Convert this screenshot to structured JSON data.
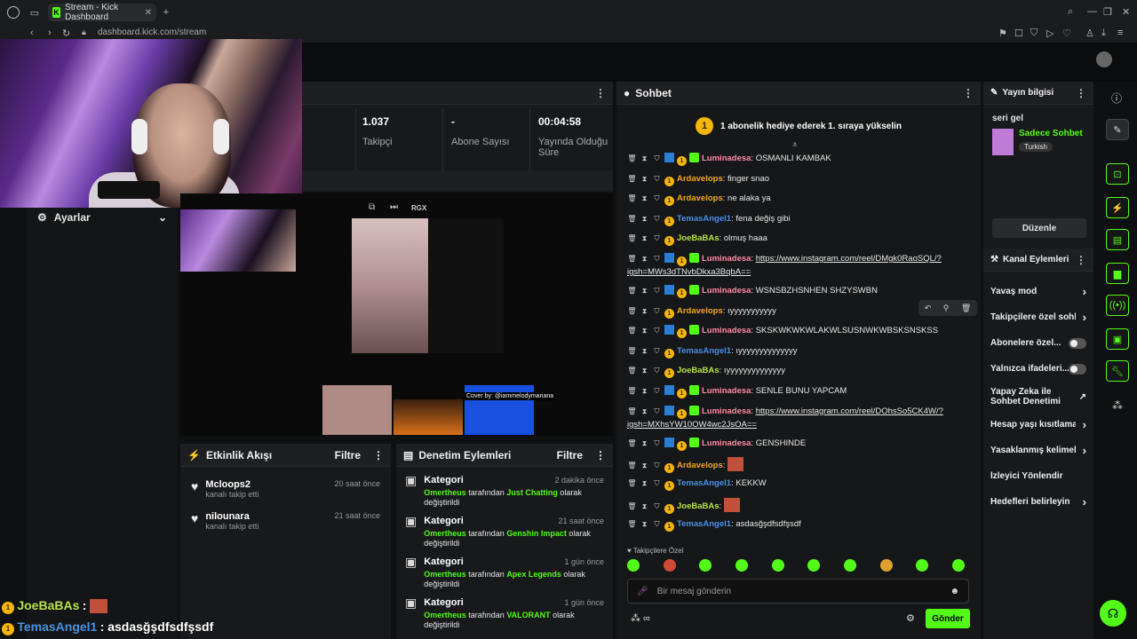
{
  "browser": {
    "tab_title": "Stream - Kick Dashboard",
    "url": "dashboard.kick.com/stream",
    "new_tab": "+"
  },
  "stats": {
    "followers_value": "1.037",
    "followers_label": "Takipçi",
    "subs_value": "-",
    "subs_label": "Abone Sayısı",
    "live_value": "00:04:58",
    "live_label": "Yayında Olduğu Süre"
  },
  "settings": {
    "label": "Ayarlar"
  },
  "preview": {
    "ctrl_label": "RGX",
    "cover_text": "Cover by: @iammelodymariana"
  },
  "activity": {
    "title": "Etkinlik Akışı",
    "filter": "Filtre",
    "items": [
      {
        "user": "Mcloops2",
        "action": "kanalı takip etti",
        "time": "20 saat önce"
      },
      {
        "user": "nilounara",
        "action": "kanalı takip etti",
        "time": "21 saat önce"
      }
    ]
  },
  "moderation": {
    "title": "Denetim Eylemleri",
    "filter": "Filtre",
    "items": [
      {
        "title": "Kategori",
        "time": "2 dakika önce",
        "user": "Omertheus",
        "mid": "tarafından",
        "target": "Just Chatting",
        "end": "olarak değiştirildi"
      },
      {
        "title": "Kategori",
        "time": "21 saat önce",
        "user": "Omertheus",
        "mid": "tarafından",
        "target": "Genshin Impact",
        "end": "olarak değiştirildi"
      },
      {
        "title": "Kategori",
        "time": "1 gün önce",
        "user": "Omertheus",
        "mid": "tarafından",
        "target": "Apex Legends",
        "end": "olarak değiştirildi"
      },
      {
        "title": "Kategori",
        "time": "1 gün önce",
        "user": "Omertheus",
        "mid": "tarafından",
        "target": "VALORANT",
        "end": "olarak değiştirildi"
      }
    ]
  },
  "chat": {
    "title": "Sohbet",
    "pinned": "1 abonelik hediye ederek 1. sıraya yükselin",
    "pinned_badge": "1",
    "followers_only_label": "Takipçilere Özel",
    "input_placeholder": "Bir mesaj gönderin",
    "send_label": "Gönder",
    "messages": [
      {
        "user": "Luminadesa",
        "color": "#ff8aa8",
        "text": "OSMANLI KAMBAK",
        "badges": 3
      },
      {
        "user": "Ardavelops",
        "color": "#f5a623",
        "text": "finger snao",
        "badges": 1
      },
      {
        "user": "Ardavelops",
        "color": "#f5a623",
        "text": "ne alaka ya",
        "badges": 1
      },
      {
        "user": "TemasAngel1",
        "color": "#4a90e2",
        "text": "fena değiş gibi",
        "badges": 1
      },
      {
        "user": "JoeBaBAs",
        "color": "#b6e24a",
        "text": "olmuş haaa",
        "badges": 1
      },
      {
        "user": "Luminadesa",
        "color": "#ff8aa8",
        "text": "https://www.instagram.com/reel/DMgk0RaoSQL/?igsh=MWs3dTNvbDkxa3BqbA==",
        "badges": 3,
        "link": true
      },
      {
        "user": "Luminadesa",
        "color": "#ff8aa8",
        "text": "WSNSBZHSNHEN SHZYSWBN",
        "badges": 3
      },
      {
        "user": "Ardavelops",
        "color": "#f5a623",
        "text": "ıyyyyyyyyyyy",
        "badges": 1
      },
      {
        "user": "Luminadesa",
        "color": "#ff8aa8",
        "text": "SKSKWKWKWLAKWLSUSNWKWBSKSNSKSS",
        "badges": 3
      },
      {
        "user": "TemasAngel1",
        "color": "#4a90e2",
        "text": "ıyyyyyyyyyyyyyy",
        "badges": 1
      },
      {
        "user": "JoeBaBAs",
        "color": "#b6e24a",
        "text": "ıyyyyyyyyyyyyyy",
        "badges": 1
      },
      {
        "user": "Luminadesa",
        "color": "#ff8aa8",
        "text": "SENLE BUNU YAPCAM",
        "badges": 3
      },
      {
        "user": "Luminadesa",
        "color": "#ff8aa8",
        "text": "https://www.instagram.com/reel/DOhsSo5CK4W/?igsh=MXhsYW10OW4wc2JsOA==",
        "badges": 3,
        "link": true
      },
      {
        "user": "Luminadesa",
        "color": "#ff8aa8",
        "text": "GENSHINDE",
        "badges": 3
      },
      {
        "user": "Ardavelops",
        "color": "#f5a623",
        "text": "",
        "badges": 1,
        "emote": true
      },
      {
        "user": "TemasAngel1",
        "color": "#4a90e2",
        "text": "KEKKW",
        "badges": 1
      },
      {
        "user": "JoeBaBAs",
        "color": "#b6e24a",
        "text": "",
        "badges": 1,
        "emote": true
      },
      {
        "user": "TemasAngel1",
        "color": "#4a90e2",
        "text": "asdasğşdfsdfşsdf",
        "badges": 1
      }
    ]
  },
  "stream_info": {
    "title": "Yayın bilgisi",
    "stream_title": "seri gel",
    "chat_mode": "Sadece Sohbet",
    "language": "Turkish",
    "edit_label": "Düzenle"
  },
  "channel_actions": {
    "title": "Kanal Eylemleri",
    "items": [
      {
        "label": "Yavaş mod",
        "control": "chevron"
      },
      {
        "label": "Takipçilere özel sohbe",
        "control": "chevron"
      },
      {
        "label": "Abonelere özel...",
        "control": "toggle"
      },
      {
        "label": "Yalnızca ifadeleri...",
        "control": "toggle"
      },
      {
        "label": "Yapay Zeka ile Sohbet Denetimi",
        "control": "external"
      },
      {
        "label": "Hesap yaşı kısıtlaması",
        "control": "chevron"
      },
      {
        "label": "Yasaklanmış kelimeler",
        "control": "chevron"
      },
      {
        "label": "İzleyici Yönlendir",
        "control": "none"
      },
      {
        "label": "Hedefleri belirleyin",
        "control": "chevron"
      }
    ]
  },
  "overlay_chat": [
    {
      "user": "JoeBaBAs",
      "color": "#b6e24a",
      "text": ":"
    },
    {
      "user": "TemasAngel1",
      "color": "#4a90e2",
      "text": ": asdasğşdfsdfşsdf"
    }
  ],
  "colors": {
    "accent": "#53fc18",
    "bg": "#0f1011",
    "panel": "#18191b"
  }
}
